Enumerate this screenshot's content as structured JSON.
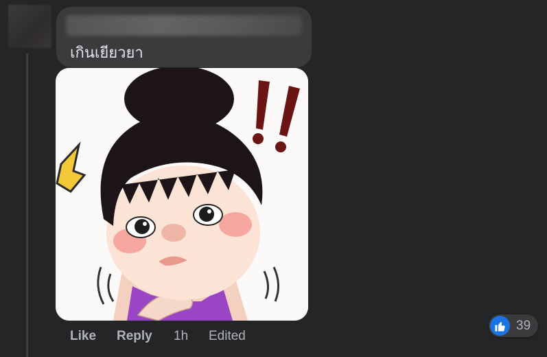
{
  "comment": {
    "text": "เกินเยียวยา",
    "sticker_icon": "cartoon-girl-sticker",
    "actions": {
      "like": "Like",
      "reply": "Reply",
      "time": "1h",
      "edited": "Edited"
    },
    "reactions": {
      "icon": "thumbs-up-icon",
      "count": "39",
      "badge_color": "#1b74e4"
    }
  },
  "colors": {
    "background": "#242526",
    "bubble": "#3a3b3c",
    "text": "#e4e6eb",
    "muted_text": "#b0b3b8"
  }
}
